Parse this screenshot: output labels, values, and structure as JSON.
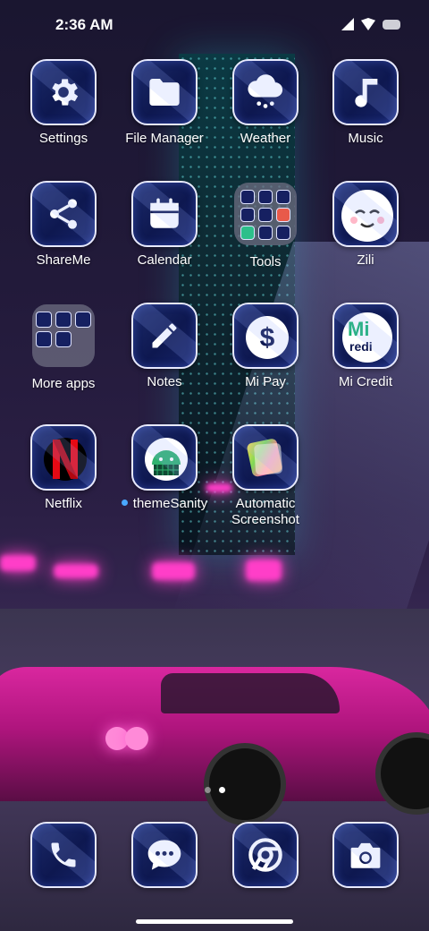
{
  "status": {
    "time": "2:36 AM"
  },
  "apps": [
    {
      "label": "Settings",
      "icon": "gear-icon"
    },
    {
      "label": "File Manager",
      "icon": "folder-icon"
    },
    {
      "label": "Weather",
      "icon": "cloud-rain-icon"
    },
    {
      "label": "Music",
      "icon": "music-note-icon"
    },
    {
      "label": "ShareMe",
      "icon": "share-icon"
    },
    {
      "label": "Calendar",
      "icon": "calendar-icon"
    },
    {
      "label": "Tools",
      "icon": "folder-tools-icon"
    },
    {
      "label": "Zili",
      "icon": "smiley-face-icon"
    },
    {
      "label": "More apps",
      "icon": "folder-more-apps-icon"
    },
    {
      "label": "Notes",
      "icon": "pencil-icon"
    },
    {
      "label": "Mi Pay",
      "icon": "dollar-icon"
    },
    {
      "label": "Mi Credit",
      "icon": "mi-credit-icon"
    },
    {
      "label": "Netflix",
      "icon": "netflix-icon"
    },
    {
      "label": "themeSanity",
      "icon": "android-icon",
      "new_dot": true
    },
    {
      "label": "Automatic",
      "label_line2": "Screenshot",
      "icon": "screenshot-icon"
    }
  ],
  "mi_credit_logo_text": "Mi",
  "mi_credit_logo_sub": "redi",
  "dock": [
    {
      "icon": "phone-icon"
    },
    {
      "icon": "message-icon"
    },
    {
      "icon": "chrome-icon"
    },
    {
      "icon": "camera-icon"
    }
  ],
  "pager": {
    "pages": 2,
    "active": 1
  },
  "colors": {
    "icon_bg": "#0e1850",
    "icon_border": "#e8eaff",
    "accent_pink": "#ff3ec8",
    "new_dot": "#4aa8ff"
  }
}
